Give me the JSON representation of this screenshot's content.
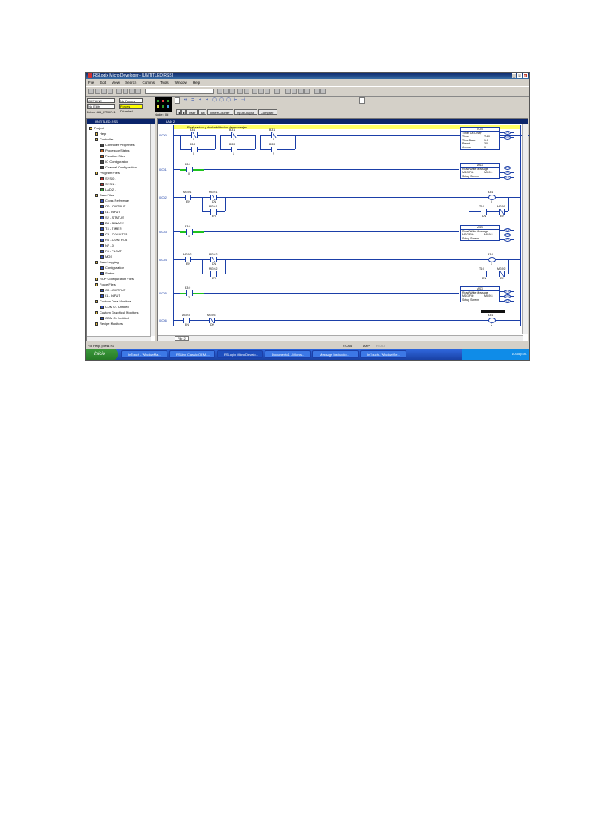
{
  "window": {
    "title": "RSLogix Micro Developer - [UNTITLED.RSS]"
  },
  "menu": [
    "File",
    "Edit",
    "View",
    "Search",
    "Comms",
    "Tools",
    "Window",
    "Help"
  ],
  "mode": {
    "rows": [
      {
        "label": "OFFLINE",
        "value": "No Forces"
      },
      {
        "label": "No Edits",
        "value": "Forces Disabled"
      }
    ],
    "driver": "Driver: AB_ETHIP-1",
    "node": "Node : 0d"
  },
  "instr_tabs": [
    "User",
    "Bit",
    "Timer/Counter",
    "Input/Output",
    "Compare"
  ],
  "project": {
    "title": "UNTITLED.RSS",
    "items": [
      {
        "label": "Project",
        "indent": 0,
        "color": "#e8c040"
      },
      {
        "label": "Help",
        "indent": 1,
        "color": "#e8c040"
      },
      {
        "label": "Controller",
        "indent": 1,
        "color": "#e8c040"
      },
      {
        "label": "Controller Properties",
        "indent": 2,
        "color": "#444"
      },
      {
        "label": "Processor Status",
        "indent": 2,
        "color": "#c06020"
      },
      {
        "label": "Function Files",
        "indent": 2,
        "color": "#c06020"
      },
      {
        "label": "IO Configuration",
        "indent": 2,
        "color": "#444"
      },
      {
        "label": "Channel Configuration",
        "indent": 2,
        "color": "#444"
      },
      {
        "label": "Program Files",
        "indent": 1,
        "color": "#e8c040"
      },
      {
        "label": "SYS 0 -",
        "indent": 2,
        "color": "#c03030"
      },
      {
        "label": "SYS 1 -",
        "indent": 2,
        "color": "#c03030"
      },
      {
        "label": "LAD 2 -",
        "indent": 2,
        "color": "#30a030"
      },
      {
        "label": "Data Files",
        "indent": 1,
        "color": "#e8c040"
      },
      {
        "label": "Cross Reference",
        "indent": 2,
        "color": "#3050c0"
      },
      {
        "label": "O0 - OUTPUT",
        "indent": 2,
        "color": "#3050c0"
      },
      {
        "label": "I1 - INPUT",
        "indent": 2,
        "color": "#3050c0"
      },
      {
        "label": "S2 - STATUS",
        "indent": 2,
        "color": "#3050c0"
      },
      {
        "label": "B3 - BINARY",
        "indent": 2,
        "color": "#3050c0"
      },
      {
        "label": "T4 - TIMER",
        "indent": 2,
        "color": "#3050c0"
      },
      {
        "label": "C5 - COUNTER",
        "indent": 2,
        "color": "#3050c0"
      },
      {
        "label": "R6 - CONTROL",
        "indent": 2,
        "color": "#3050c0"
      },
      {
        "label": "N7 - 0",
        "indent": 2,
        "color": "#3050c0"
      },
      {
        "label": "F8 - FLOAT",
        "indent": 2,
        "color": "#3050c0"
      },
      {
        "label": "MG9",
        "indent": 2,
        "color": "#3050c0"
      },
      {
        "label": "Data Logging",
        "indent": 1,
        "color": "#e8c040"
      },
      {
        "label": "Configuration",
        "indent": 2,
        "color": "#3050c0"
      },
      {
        "label": "Status",
        "indent": 2,
        "color": "#3050c0"
      },
      {
        "label": "RCP Configuration Files",
        "indent": 1,
        "color": "#e8c040"
      },
      {
        "label": "Force Files",
        "indent": 1,
        "color": "#e8c040"
      },
      {
        "label": "O0 - OUTPUT",
        "indent": 2,
        "color": "#3050c0"
      },
      {
        "label": "I1 - INPUT",
        "indent": 2,
        "color": "#3050c0"
      },
      {
        "label": "Custom Data Monitors",
        "indent": 1,
        "color": "#e8c040"
      },
      {
        "label": "CDM 0 - Untitled",
        "indent": 2,
        "color": "#3050c0"
      },
      {
        "label": "Custom Graphical Monitors",
        "indent": 1,
        "color": "#e8c040"
      },
      {
        "label": "GDM 0 - Untitled",
        "indent": 2,
        "color": "#3050c0"
      },
      {
        "label": "Recipe Monitors",
        "indent": 1,
        "color": "#e8c040"
      }
    ]
  },
  "ladder": {
    "title": "LAD 2",
    "comment": "Realizacion y deshabilitacion de mensajes",
    "rungs": [
      "0000",
      "0001",
      "0002",
      "0003",
      "0004",
      "0005",
      "0006"
    ],
    "contacts": [
      {
        "tag": "B3:1",
        "sub": "0"
      },
      {
        "tag": "B3:1",
        "sub": "1"
      },
      {
        "tag": "B3:1",
        "sub": "2"
      },
      {
        "tag": "B3:0",
        "sub": "0"
      },
      {
        "tag": "B3:0",
        "sub": "1"
      },
      {
        "tag": "B3:0",
        "sub": "2"
      },
      {
        "tag": "B3:0",
        "sub": "0"
      },
      {
        "tag": "MG9:1",
        "sub": "EN"
      },
      {
        "tag": "MG9:1",
        "sub": "DN"
      },
      {
        "tag": "MG9:1",
        "sub": "ER"
      },
      {
        "tag": "T4:0",
        "sub": "DN"
      },
      {
        "tag": "MG9:1",
        "sub": "EN"
      },
      {
        "tag": "B3:0",
        "sub": "1"
      },
      {
        "tag": "MG9:2",
        "sub": "EN"
      },
      {
        "tag": "MG9:2",
        "sub": "DN"
      },
      {
        "tag": "MG9:2",
        "sub": "ER"
      },
      {
        "tag": "T4:0",
        "sub": "DN"
      },
      {
        "tag": "MG9:2",
        "sub": "EN"
      },
      {
        "tag": "B3:0",
        "sub": "2"
      },
      {
        "tag": "MG9:3",
        "sub": "EN"
      },
      {
        "tag": "MG9:3",
        "sub": "DN"
      }
    ],
    "coils": [
      {
        "tag": "B3:1",
        "sub": "0"
      },
      {
        "tag": "B3:1",
        "sub": "1"
      },
      {
        "tag": "B3:1",
        "sub": "2"
      }
    ],
    "ton": {
      "name": "TON",
      "desc": "Timer On Delay",
      "rows": [
        [
          "Timer",
          "T4:0"
        ],
        [
          "Time Base",
          "1.0"
        ],
        [
          "Preset",
          "30"
        ],
        [
          "Accum",
          "0"
        ]
      ],
      "outs": [
        "EN",
        "DN"
      ]
    },
    "msgs": [
      {
        "name": "MSG",
        "desc": "Read/Write Message",
        "file": "MSG File",
        "fval": "MG9:1",
        "setup": "Setup Screen",
        "outs": [
          "EN",
          "DN",
          "ER"
        ]
      },
      {
        "name": "MSG",
        "desc": "Read/Write Message",
        "file": "MSG File",
        "fval": "MG9:2",
        "setup": "Setup Screen",
        "outs": [
          "EN",
          "DN",
          "ER"
        ]
      },
      {
        "name": "MSG",
        "desc": "Read/Write Message",
        "file": "MSG File",
        "fval": "MG9:3",
        "setup": "Setup Screen",
        "outs": [
          "EN",
          "DN",
          "ER"
        ]
      }
    ],
    "file_tab": "File 2"
  },
  "status": {
    "help": "For Help, press F1",
    "pos": "2:0006",
    "app": "APP",
    "mode": "READ"
  },
  "taskbar": {
    "start": "Inicio",
    "buttons": [
      "InTouch - WindowMa...",
      "RSLinx Classic OEM -...",
      "RSLogix Micro Develo...",
      "Documento1 - Micros...",
      "Message Instructio...",
      "InTouch - WindowVie..."
    ],
    "clock": "10:35 p.m."
  },
  "colors": {
    "rung": "#1b3fa8",
    "energized": "#1ec31e",
    "comment": "#ffff66",
    "titlebar": "#0a246a"
  }
}
